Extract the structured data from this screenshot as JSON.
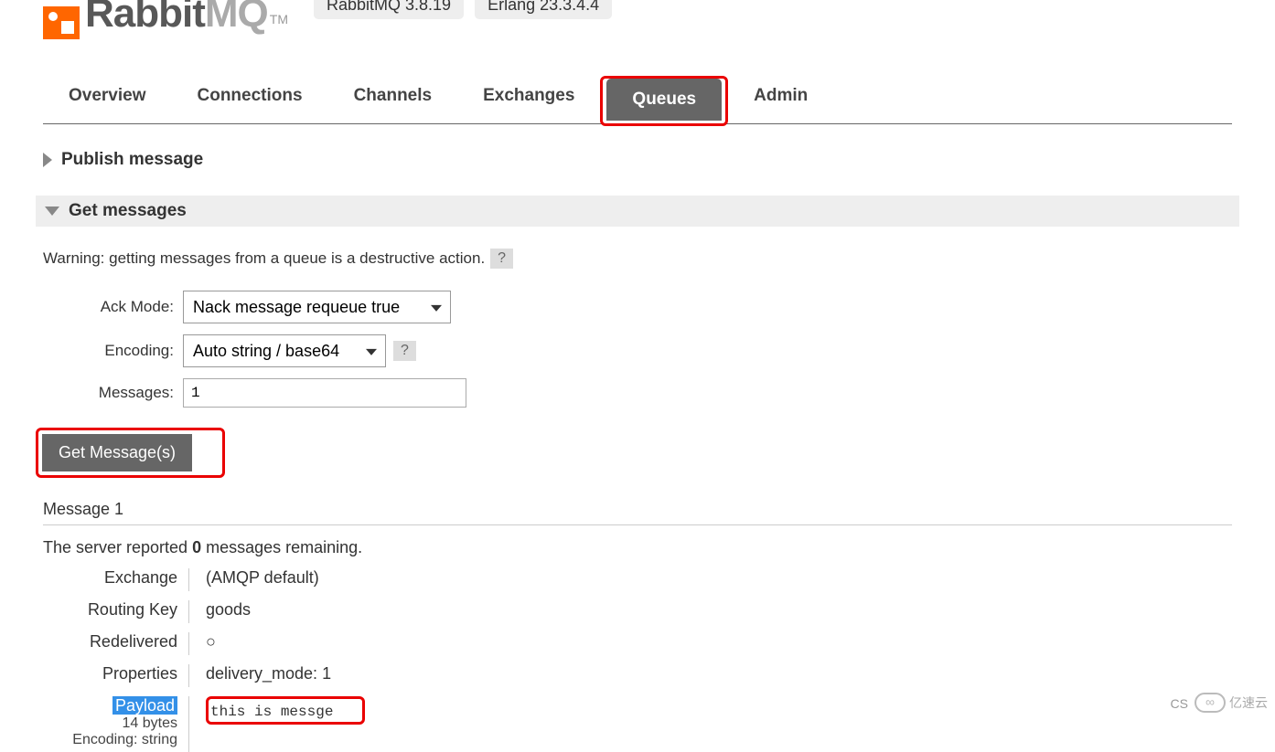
{
  "header": {
    "logo_part1": "Rabbit",
    "logo_part2": "MQ",
    "tm": "TM",
    "version_rabbitmq": "RabbitMQ 3.8.19",
    "version_erlang": "Erlang 23.3.4.4"
  },
  "tabs": {
    "items": [
      {
        "label": "Overview"
      },
      {
        "label": "Connections"
      },
      {
        "label": "Channels"
      },
      {
        "label": "Exchanges"
      },
      {
        "label": "Queues",
        "active": true,
        "highlight": true
      },
      {
        "label": "Admin"
      }
    ]
  },
  "sections": {
    "publish": {
      "title": "Publish message"
    },
    "get": {
      "title": "Get messages",
      "warning": "Warning: getting messages from a queue is a destructive action.",
      "help": "?"
    }
  },
  "form": {
    "ack_mode_label": "Ack Mode:",
    "ack_mode_value": "Nack message requeue true",
    "encoding_label": "Encoding:",
    "encoding_value": "Auto string / base64",
    "encoding_help": "?",
    "messages_label": "Messages:",
    "messages_value": "1",
    "get_button": "Get Message(s)"
  },
  "result": {
    "header": "Message 1",
    "remaining_pre": "The server reported ",
    "remaining_count": "0",
    "remaining_post": " messages remaining.",
    "rows": {
      "exchange_label": "Exchange",
      "exchange_value": "(AMQP default)",
      "routing_key_label": "Routing Key",
      "routing_key_value": "goods",
      "redelivered_label": "Redelivered",
      "redelivered_value": "○",
      "properties_label": "Properties",
      "properties_key": "delivery_mode:",
      "properties_val": "1",
      "payload_label": "Payload",
      "payload_bytes": "14 bytes",
      "payload_encoding": "Encoding: string",
      "payload_value": "this is messge"
    }
  },
  "watermark": {
    "text1": "CS",
    "text2": "亿速云"
  }
}
